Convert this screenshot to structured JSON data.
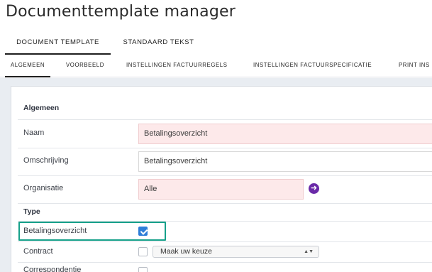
{
  "title": "Documenttemplate manager",
  "tabs_primary": [
    "DOCUMENT TEMPLATE",
    "STANDAARD TEKST"
  ],
  "tabs_secondary": [
    "ALGEMEEN",
    "VOORBEELD",
    "INSTELLINGEN FACTUURREGELS",
    "INSTELLINGEN FACTUURSPECIFICATIE",
    "PRINT INS"
  ],
  "section_algemeen": "Algemeen",
  "fields": {
    "naam": {
      "label": "Naam",
      "value": "Betalingsoverzicht"
    },
    "omschrijving": {
      "label": "Omschrijving",
      "value": "Betalingsoverzicht"
    },
    "organisatie": {
      "label": "Organisatie",
      "value": "Alle"
    }
  },
  "section_type": "Type",
  "type_options": {
    "betalingsoverzicht": {
      "label": "Betalingsoverzicht",
      "checked": true
    },
    "contract": {
      "label": "Contract",
      "checked": false,
      "select_value": "Maak uw keuze"
    },
    "correspondentie": {
      "label": "Correspondentie",
      "checked": false
    }
  },
  "colors": {
    "required_bg": "#fde9ea",
    "accent": "#6a2aa8",
    "checkbox": "#2f7ed8",
    "highlight": "#16a08a"
  },
  "icons": {
    "organisatie_action": "arrow-right-circle-icon",
    "select": "chevron-updown-icon"
  }
}
